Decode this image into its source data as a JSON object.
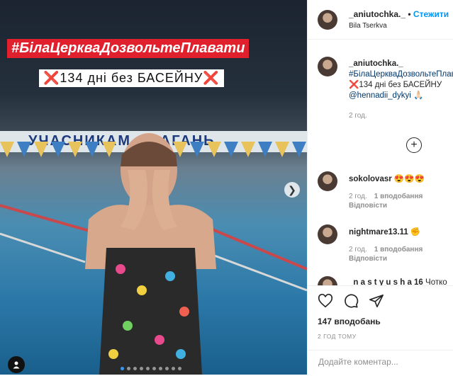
{
  "post": {
    "hashtag": "#БілаЦеркваДозвольтеПлавати",
    "subline_mark_left": "❌",
    "subline_text": "134 дні без БАСЕЙНУ",
    "subline_mark_right": "❌",
    "banner_text": "УЧАСНИКАМ ЗМАГАНЬ"
  },
  "header": {
    "username": "_aniutochka._",
    "separator": " • ",
    "follow_label": "Стежити",
    "location": "Bila Tserkva"
  },
  "caption": {
    "username": "_aniutochka._",
    "hashtag": "#БілаЦеркваДозвольтеПлавати",
    "line2": "❌134 дні без БАСЕЙНУ",
    "mention": "@hennadii_dykyi",
    "mention_emoji": " 🙏🏻",
    "time": "2 год."
  },
  "comments": [
    {
      "username": "sokolovasr",
      "text": " 😍😍😍",
      "time": "2 год.",
      "likes": "1 вподобання",
      "reply": "Відповісти"
    },
    {
      "username": "nightmare13.11",
      "text": " ✊",
      "time": "2 год.",
      "likes": "1 вподобання",
      "reply": "Відповісти"
    },
    {
      "username": "_n a s t y u s h a 16",
      "text": " Чотко"
    }
  ],
  "actions": {
    "likes": "147 вподобань",
    "ago": "2 ГОД ТОМУ",
    "comment_placeholder": "Додайте коментар..."
  },
  "colors": {
    "accent": "#0095f6",
    "hashtag_bg": "#e0202c"
  }
}
